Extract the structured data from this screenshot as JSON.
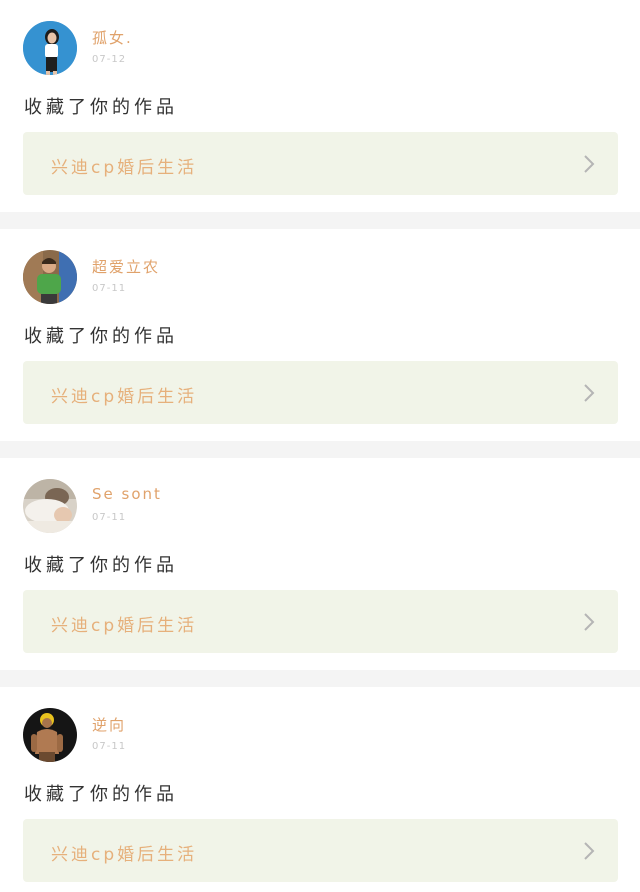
{
  "notifications": [
    {
      "username": "孤女.",
      "date": "07-12",
      "action": "收藏了你的作品",
      "work_title": "兴迪cp婚后生活",
      "avatar_icon": "avatar-girl-blue-background"
    },
    {
      "username": "超爱立农",
      "date": "07-11",
      "action": "收藏了你的作品",
      "work_title": "兴迪cp婚后生活",
      "avatar_icon": "avatar-person-green-shirt"
    },
    {
      "username": "Se sont",
      "date": "07-11",
      "action": "收藏了你的作品",
      "work_title": "兴迪cp婚后生活",
      "avatar_icon": "avatar-sleeping-person"
    },
    {
      "username": "逆向",
      "date": "07-11",
      "action": "收藏了你的作品",
      "work_title": "兴迪cp婚后生活",
      "avatar_icon": "avatar-yellow-hair-figure"
    }
  ],
  "colors": {
    "username": "#e0a26b",
    "work_title": "#e6b07b",
    "work_link_bg": "#f1f4e8",
    "page_bg": "#f4f4f4"
  }
}
